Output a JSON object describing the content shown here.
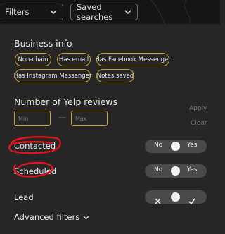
{
  "topbar": {
    "filters_label": "Filters",
    "saved_searches_label": "Saved searches"
  },
  "business_info": {
    "title": "Business info",
    "chips": [
      "Non-chain",
      "Has email",
      "Has Facebook Messenger",
      "Has Instagram Messenger",
      "Notes saved"
    ]
  },
  "reviews": {
    "title": "Number of Yelp reviews",
    "min_placeholder": "Min",
    "max_placeholder": "Max",
    "dash": "—",
    "apply_label": "Apply",
    "clear_label": "Clear"
  },
  "contacted": {
    "label": "Contacted",
    "no": "No",
    "yes": "Yes",
    "value": "none"
  },
  "scheduled": {
    "label": "Scheduled",
    "no": "No",
    "yes": "Yes",
    "value": "none"
  },
  "lead": {
    "label": "Lead",
    "no_icon": "x-icon",
    "yes_icon": "check-icon",
    "value": "none"
  },
  "advanced_filters": {
    "label": "Advanced filters"
  },
  "annotations": {
    "color": "#e0141b"
  },
  "colors": {
    "accent": "#c9a227",
    "background": "#262626",
    "topbar": "#151515",
    "toggle": "#4a4a4a"
  }
}
